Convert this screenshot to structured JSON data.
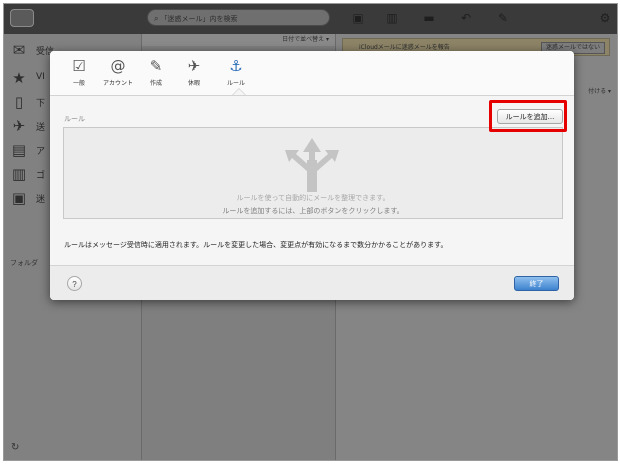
{
  "background": {
    "search_placeholder": "「迷惑メール」内を検索",
    "sort_label": "日付で並べ替え ▾",
    "banner_text": "iCloudメールに迷惑メールを報告",
    "banner_button": "迷惑メールではない",
    "reading_tail": "付ける ▾",
    "sidebar_items": [
      {
        "icon": "inbox-icon",
        "glyph": "✉",
        "label": "受信"
      },
      {
        "icon": "star-icon",
        "glyph": "★",
        "label": "VI"
      },
      {
        "icon": "document-icon",
        "glyph": "▯",
        "label": "下"
      },
      {
        "icon": "send-icon",
        "glyph": "✈",
        "label": "送"
      },
      {
        "icon": "archive-icon",
        "glyph": "▤",
        "label": "ア"
      },
      {
        "icon": "trash-icon",
        "glyph": "▥",
        "label": "ゴ"
      },
      {
        "icon": "junk-icon",
        "glyph": "▣",
        "label": "迷"
      }
    ],
    "folder_label": "フォルダ",
    "refresh_glyph": "↻"
  },
  "modal": {
    "tabs": [
      {
        "id": "general",
        "label": "一般",
        "glyph": "☑"
      },
      {
        "id": "account",
        "label": "アカウント",
        "glyph": "@"
      },
      {
        "id": "compose",
        "label": "作成",
        "glyph": "✎"
      },
      {
        "id": "vacation",
        "label": "休暇",
        "glyph": "✈"
      },
      {
        "id": "rules",
        "label": "ルール",
        "glyph": "⚓",
        "active": true
      }
    ],
    "section_label": "ルール",
    "add_rule_button": "ルールを追加...",
    "empty_line1": "ルールを使って自動的にメールを整理できます。",
    "empty_line2": "ルールを追加するには、上部のボタンをクリックします。",
    "note": "ルールはメッセージ受信時に適用されます。ルールを変更した場合、変更点が有効になるまで数分かかることがあります。",
    "help_button": "?",
    "done_button": "終了"
  }
}
